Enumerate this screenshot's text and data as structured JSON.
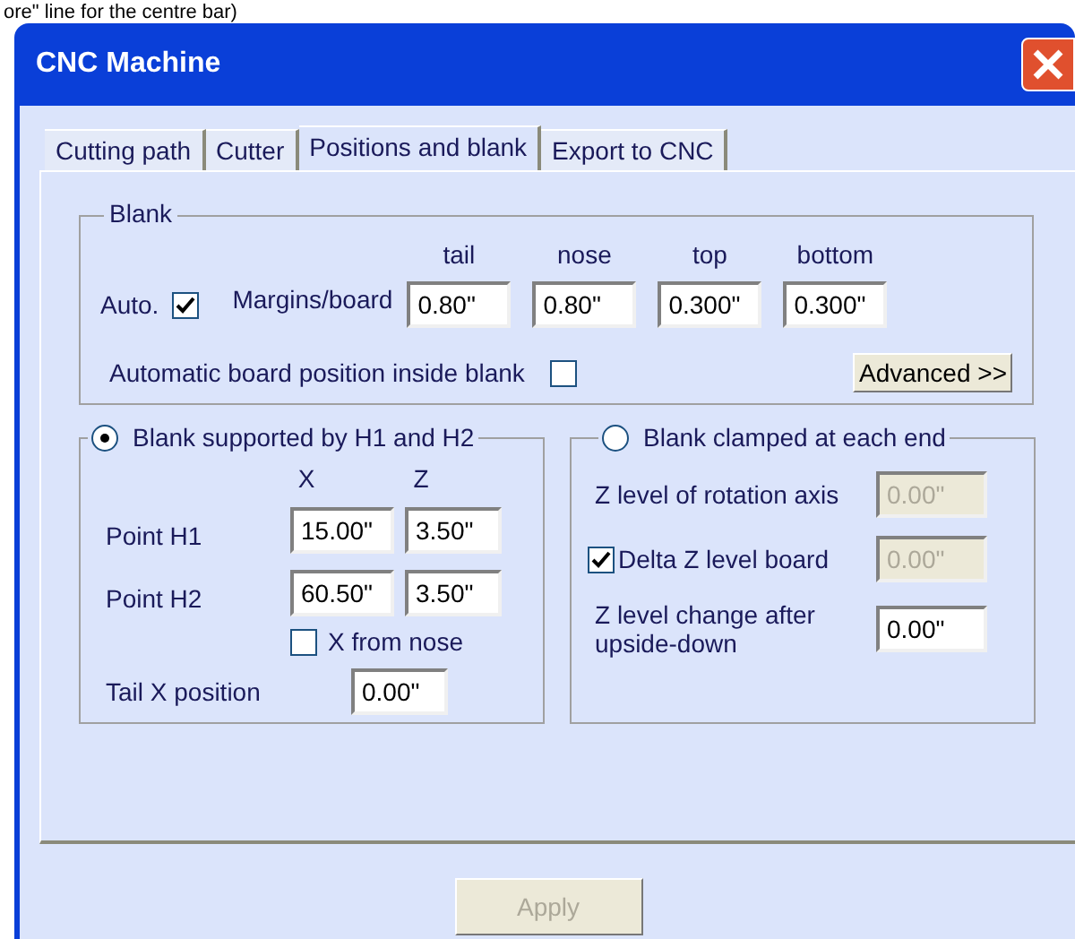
{
  "caption": "ore\" line for the centre bar)",
  "window": {
    "title": "CNC Machine"
  },
  "tabs": [
    {
      "label": "Cutting path",
      "selected": false
    },
    {
      "label": "Cutter",
      "selected": false
    },
    {
      "label": "Positions and blank",
      "selected": true
    },
    {
      "label": "Export to CNC",
      "selected": false
    }
  ],
  "blank": {
    "title": "Blank",
    "auto": {
      "label": "Auto.",
      "checked": true
    },
    "margins_label": "Margins/board",
    "margins": [
      {
        "label": "tail",
        "value": "0.80\""
      },
      {
        "label": "nose",
        "value": "0.80\""
      },
      {
        "label": "top",
        "value": "0.300\""
      },
      {
        "label": "bottom",
        "value": "0.300\""
      }
    ],
    "auto_position": {
      "label": "Automatic board position inside blank",
      "checked": false
    },
    "advanced_button": "Advanced >>"
  },
  "supported": {
    "label": "Blank supported by H1 and H2",
    "selected": true,
    "columns": [
      "X",
      "Z"
    ],
    "points": [
      {
        "label": "Point H1",
        "x": "15.00\"",
        "z": "3.50\""
      },
      {
        "label": "Point H2",
        "x": "60.50\"",
        "z": "3.50\""
      }
    ],
    "x_from_nose": {
      "label": "X from nose",
      "checked": false
    },
    "tail_label": "Tail X position",
    "tail_value": "0.00\""
  },
  "clamped": {
    "label": "Blank clamped at each end",
    "selected": false,
    "rows": [
      {
        "kind": "field",
        "label": "Z level of rotation axis",
        "value": "0.00\"",
        "disabled": true
      },
      {
        "kind": "checkbox",
        "label": "Delta Z level board",
        "checked": true,
        "value": "0.00\"",
        "disabled": true
      },
      {
        "kind": "field",
        "label": "Z level change after upside-down",
        "value": "0.00\"",
        "disabled": false
      }
    ]
  },
  "apply_button": {
    "label": "Apply",
    "disabled": true
  }
}
